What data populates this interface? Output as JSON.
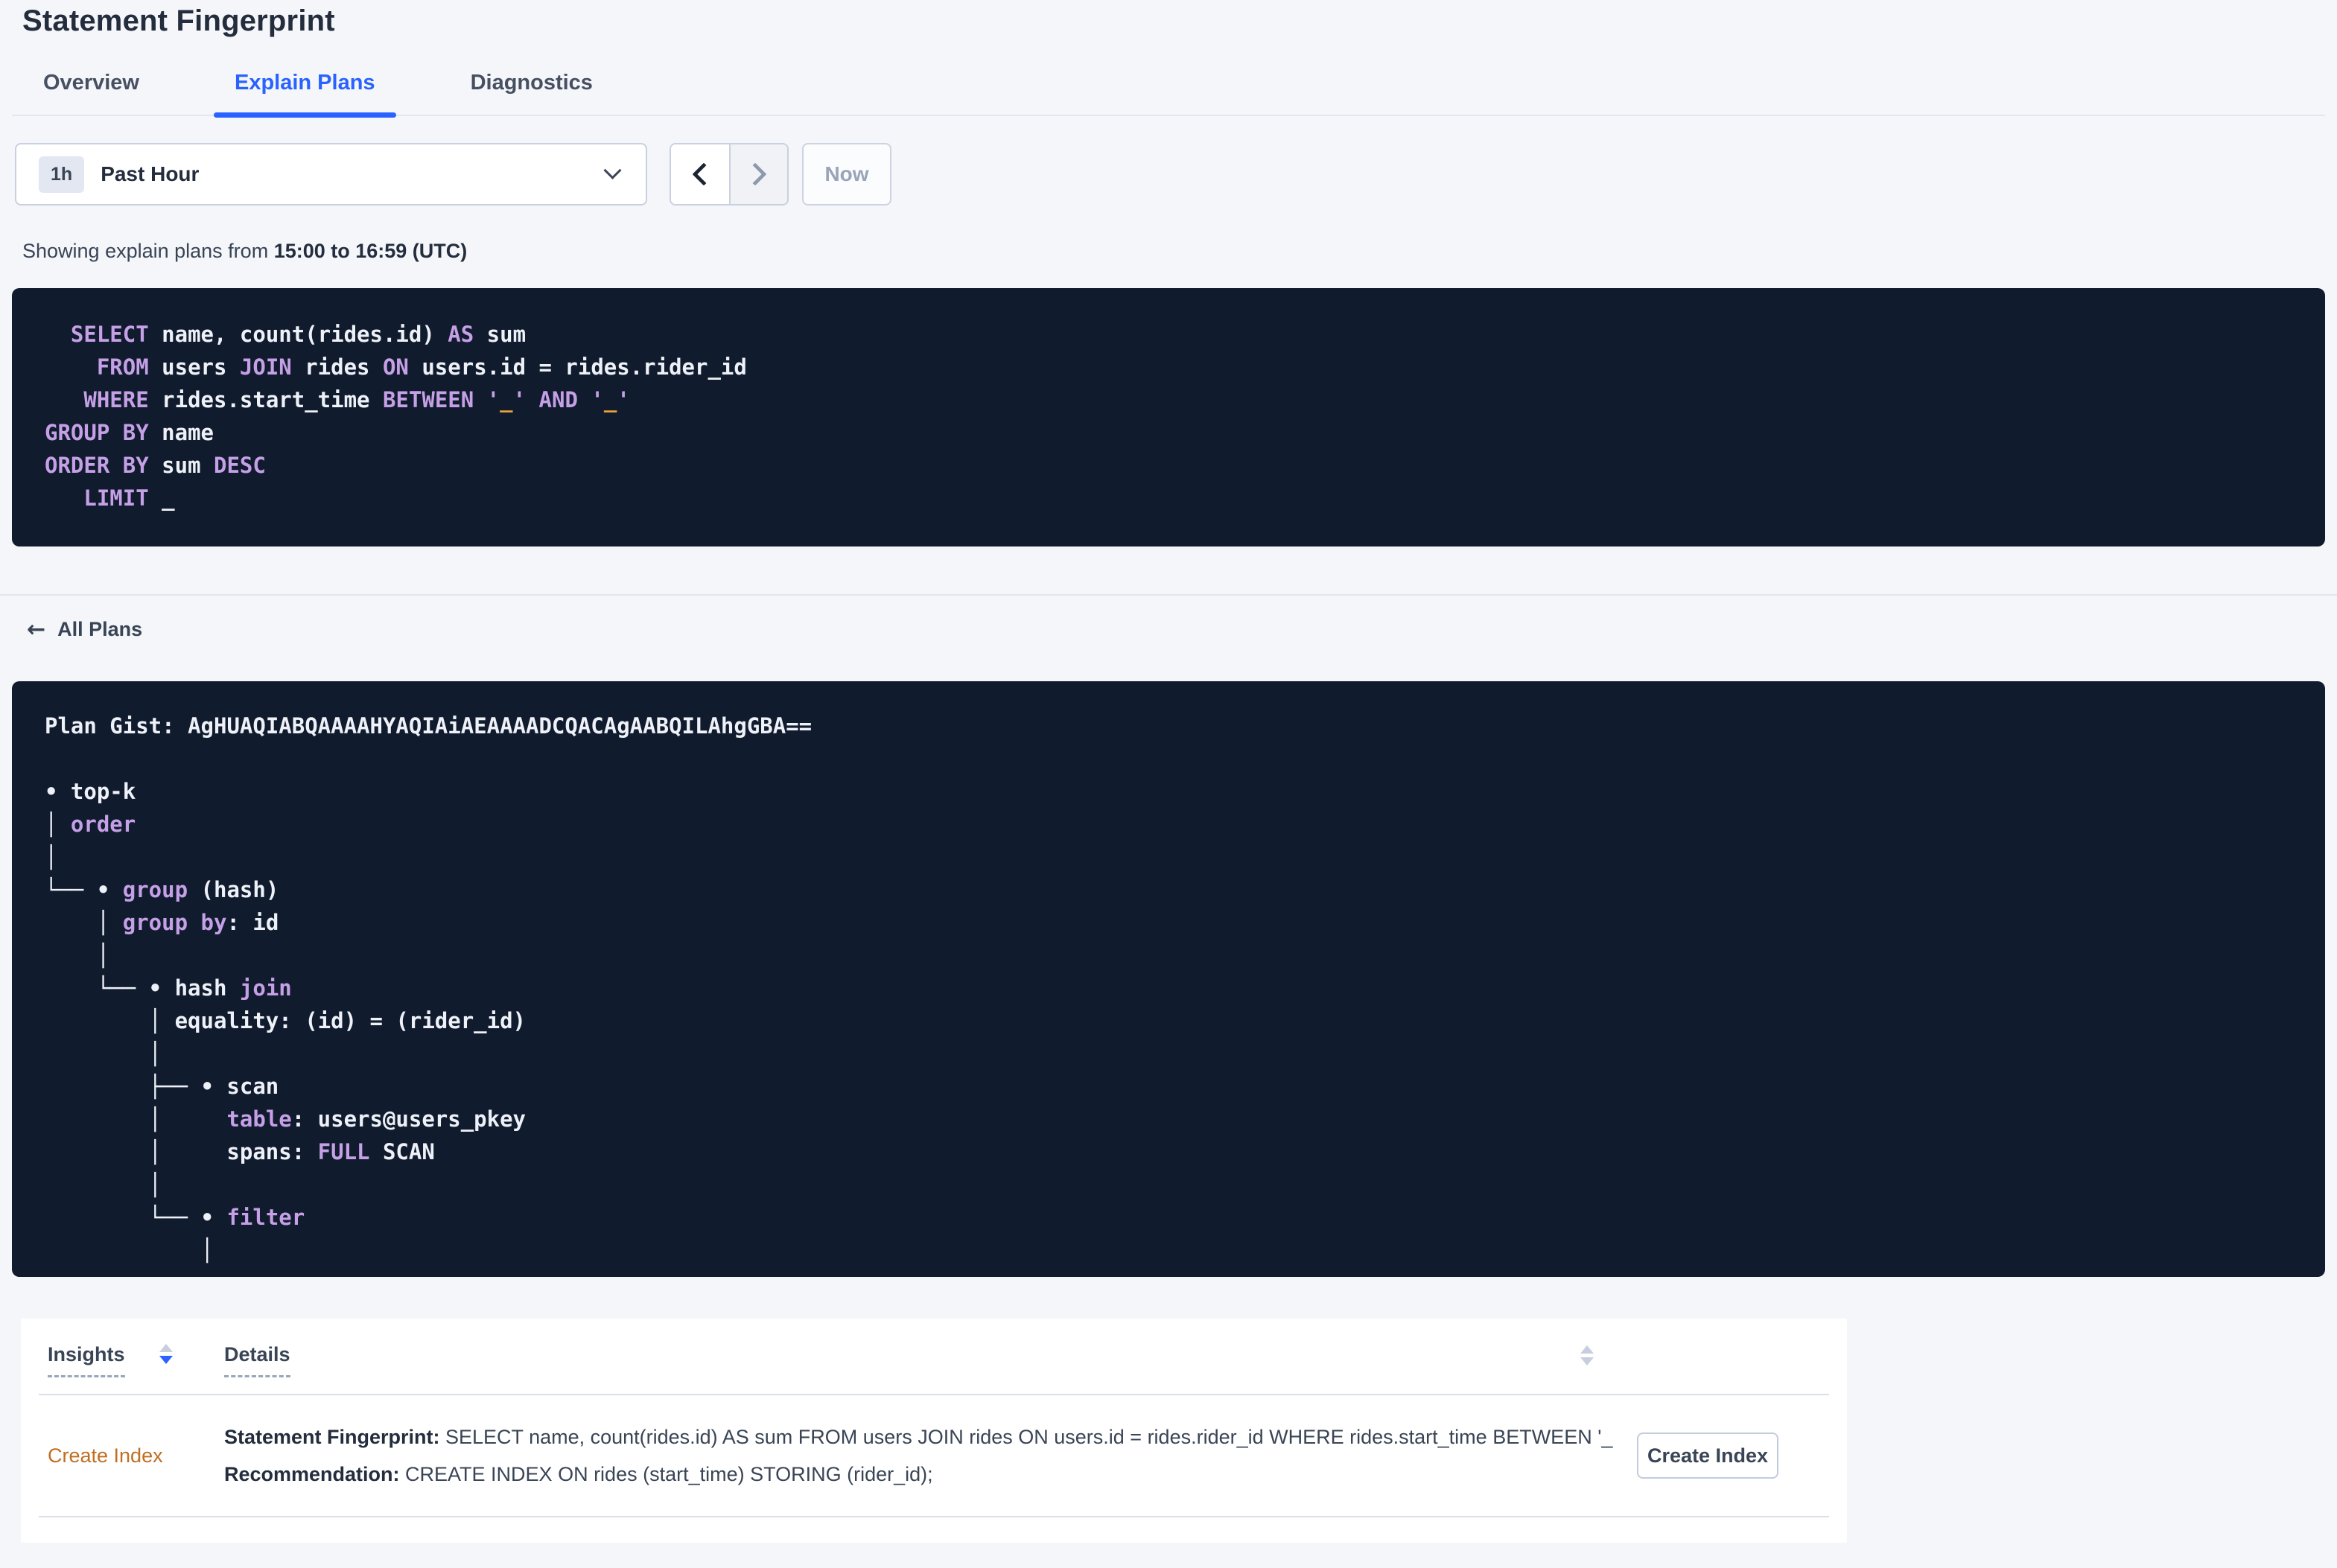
{
  "page": {
    "title": "Statement Fingerprint"
  },
  "tabs": [
    {
      "label": "Overview",
      "active": false
    },
    {
      "label": "Explain Plans",
      "active": true
    },
    {
      "label": "Diagnostics",
      "active": false
    }
  ],
  "time_picker": {
    "badge": "1h",
    "label": "Past Hour",
    "now_label": "Now"
  },
  "showing": {
    "prefix": "Showing explain plans from ",
    "bold": "15:00 to 16:59 (UTC)"
  },
  "sql": {
    "lines": [
      [
        [
          "p",
          "  "
        ],
        [
          "k",
          "SELECT"
        ],
        [
          "p",
          " name, count(rides.id) "
        ],
        [
          "k",
          "AS"
        ],
        [
          "p",
          " sum"
        ]
      ],
      [
        [
          "p",
          "    "
        ],
        [
          "k",
          "FROM"
        ],
        [
          "p",
          " users "
        ],
        [
          "k",
          "JOIN"
        ],
        [
          "p",
          " rides "
        ],
        [
          "k",
          "ON"
        ],
        [
          "p",
          " users.id = rides.rider_id"
        ]
      ],
      [
        [
          "p",
          "   "
        ],
        [
          "k",
          "WHERE"
        ],
        [
          "p",
          " rides.start_time "
        ],
        [
          "k",
          "BETWEEN"
        ],
        [
          "p",
          " "
        ],
        [
          "k",
          "'"
        ],
        [
          "o",
          "_"
        ],
        [
          "k",
          "'"
        ],
        [
          "p",
          " "
        ],
        [
          "k",
          "AND"
        ],
        [
          "p",
          " "
        ],
        [
          "k",
          "'"
        ],
        [
          "o",
          "_"
        ],
        [
          "k",
          "'"
        ]
      ],
      [
        [
          "k",
          "GROUP BY"
        ],
        [
          "p",
          " name"
        ]
      ],
      [
        [
          "k",
          "ORDER BY"
        ],
        [
          "p",
          " sum "
        ],
        [
          "k",
          "DESC"
        ]
      ],
      [
        [
          "p",
          "   "
        ],
        [
          "k",
          "LIMIT"
        ],
        [
          "p",
          " _"
        ]
      ]
    ]
  },
  "plan": {
    "all_plans_label": "All Plans",
    "gist_label": "Plan Gist: ",
    "gist": "AgHUAQIABQAAAAHYAQIAiAEAAAADCQACAgAABQILAhgGBA==",
    "tree_lines": [
      [
        [
          "p",
          "• top-k"
        ]
      ],
      [
        [
          "p",
          "│ "
        ],
        [
          "k",
          "order"
        ]
      ],
      [
        [
          "p",
          "│"
        ]
      ],
      [
        [
          "p",
          "└── • "
        ],
        [
          "k",
          "group"
        ],
        [
          "p",
          " (hash)"
        ]
      ],
      [
        [
          "p",
          "    │ "
        ],
        [
          "k",
          "group by"
        ],
        [
          "p",
          ": id"
        ]
      ],
      [
        [
          "p",
          "    │"
        ]
      ],
      [
        [
          "p",
          "    └── • hash "
        ],
        [
          "k",
          "join"
        ]
      ],
      [
        [
          "p",
          "        │ equality: (id) = (rider_id)"
        ]
      ],
      [
        [
          "p",
          "        │"
        ]
      ],
      [
        [
          "p",
          "        ├── • scan"
        ]
      ],
      [
        [
          "p",
          "        │     "
        ],
        [
          "k",
          "table"
        ],
        [
          "p",
          ": users@users_pkey"
        ]
      ],
      [
        [
          "p",
          "        │     spans: "
        ],
        [
          "k",
          "FULL"
        ],
        [
          "p",
          " SCAN"
        ]
      ],
      [
        [
          "p",
          "        │"
        ]
      ],
      [
        [
          "p",
          "        └── • "
        ],
        [
          "k",
          "filter"
        ]
      ],
      [
        [
          "p",
          "            │"
        ]
      ]
    ]
  },
  "insights_table": {
    "headers": {
      "insights": "Insights",
      "details": "Details"
    },
    "rows": [
      {
        "insight": "Create Index",
        "fingerprint_label": "Statement Fingerprint:",
        "fingerprint": " SELECT name, count(rides.id) AS sum FROM users JOIN rides ON users.id = rides.rider_id WHERE rides.start_time BETWEEN '_…",
        "recommendation_label": "Recommendation:",
        "recommendation": " CREATE INDEX ON rides (start_time) STORING (rider_id);",
        "action_label": "Create Index"
      }
    ]
  },
  "colors": {
    "accent_blue": "#2962ff",
    "code_bg": "#101b2e",
    "code_keyword": "#c5a0e6",
    "code_literal": "#e9a03c",
    "insight_orange": "#c06e1f"
  }
}
